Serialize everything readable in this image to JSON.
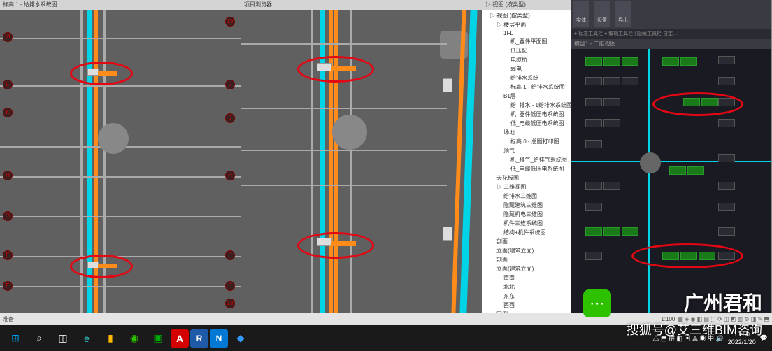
{
  "viewport1": {
    "tab": "标高 1 - 给排水系统图"
  },
  "viewport2": {
    "tab": "项目浏览器"
  },
  "viewport3": {
    "tab": "▷ 视图 (按类型)"
  },
  "viewport4": {
    "tab": "模型1 - 二维视图",
    "toolbar": {
      "btn1": "实体",
      "btn2": "设置",
      "btn3": "导出"
    },
    "subbar": "● 标准工具栏  ● 编辑工具栏 | 隐藏工具栏  自定…"
  },
  "tree": [
    {
      "l": 1,
      "t": "▷ 视图 (按类型)"
    },
    {
      "l": 2,
      "t": "▷ 楼层平面"
    },
    {
      "l": 3,
      "t": "1FL"
    },
    {
      "l": 4,
      "t": "机_器件平面图"
    },
    {
      "l": 4,
      "t": "低压配"
    },
    {
      "l": 4,
      "t": "电缆桥"
    },
    {
      "l": 4,
      "t": "弱电"
    },
    {
      "l": 4,
      "t": "给排水系统"
    },
    {
      "l": 4,
      "t": "标高 1 - 给排水系统图"
    },
    {
      "l": 3,
      "t": "B1层"
    },
    {
      "l": 4,
      "t": "给_排水 - 1给排水系统图"
    },
    {
      "l": 4,
      "t": "机_器件低压电系统图"
    },
    {
      "l": 4,
      "t": "低_电缆低压电系统图"
    },
    {
      "l": 3,
      "t": "场地"
    },
    {
      "l": 4,
      "t": "标高 0 - 总图打印图"
    },
    {
      "l": 3,
      "t": "顶气"
    },
    {
      "l": 4,
      "t": "机_排气_给排气系统图"
    },
    {
      "l": 4,
      "t": "低_电缆低压电系统图"
    },
    {
      "l": 2,
      "t": "天花板图"
    },
    {
      "l": 2,
      "t": "▷ 三维视图"
    },
    {
      "l": 3,
      "t": "给排水三维图"
    },
    {
      "l": 3,
      "t": "隐藏建筑三维图"
    },
    {
      "l": 3,
      "t": "隐藏机电三维图"
    },
    {
      "l": 3,
      "t": "机件三维系统图"
    },
    {
      "l": 3,
      "t": "结构+机件系统图"
    },
    {
      "l": 2,
      "t": "剖面"
    },
    {
      "l": 2,
      "t": "立面(建筑立面)"
    },
    {
      "l": 2,
      "t": "剖面"
    },
    {
      "l": 2,
      "t": "立面(建筑立面)"
    },
    {
      "l": 3,
      "t": "南南"
    },
    {
      "l": 3,
      "t": "北北"
    },
    {
      "l": 3,
      "t": "东东"
    },
    {
      "l": 3,
      "t": "西西"
    },
    {
      "l": 2,
      "t": "图例"
    }
  ],
  "grid_markers": [
    "M",
    "N",
    "L",
    "K",
    "H",
    "G",
    "F",
    "E",
    "19",
    "18"
  ],
  "taskbar": {
    "left": "准备",
    "coords": "1:100"
  },
  "win": {
    "time": "15:50",
    "date": "2022/1/20"
  },
  "watermark": {
    "main": "广州君和",
    "sub": "搜狐号@艾三维BIM咨询"
  }
}
